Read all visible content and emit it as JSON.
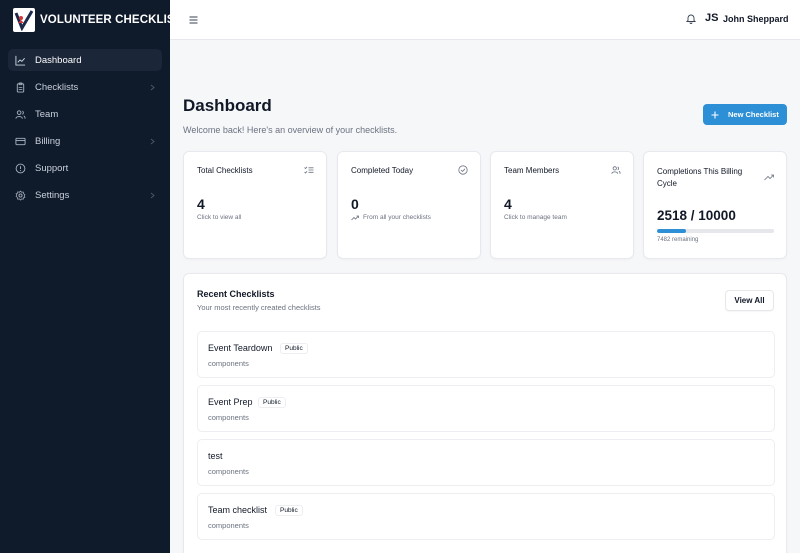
{
  "brand": {
    "name": "VOLUNTEER CHECKLIST"
  },
  "sidebar": {
    "items": [
      {
        "label": "Dashboard",
        "icon": "chart-line-icon"
      },
      {
        "label": "Checklists",
        "icon": "clipboard-icon"
      },
      {
        "label": "Team",
        "icon": "users-icon"
      },
      {
        "label": "Billing",
        "icon": "credit-card-icon"
      },
      {
        "label": "Support",
        "icon": "help-circle-icon"
      },
      {
        "label": "Settings",
        "icon": "gear-icon"
      }
    ]
  },
  "header": {
    "avatar_initials": "JS",
    "user_name": "John Sheppard"
  },
  "page": {
    "title": "Dashboard",
    "subtitle": "Welcome back! Here's an overview of your checklists.",
    "new_button": "New Checklist"
  },
  "stats": {
    "total": {
      "title": "Total Checklists",
      "value": "4",
      "note": "Click to view all"
    },
    "completed": {
      "title": "Completed Today",
      "value": "0",
      "note": "From all your checklists"
    },
    "team": {
      "title": "Team Members",
      "value": "4",
      "note": "Click to manage team"
    },
    "billing": {
      "title": "Completions This Billing Cycle",
      "value": "2518 / 10000",
      "note": "7482 remaining",
      "progress": 0.2518
    }
  },
  "recent": {
    "title": "Recent Checklists",
    "subtitle": "Your most recently created checklists",
    "view_all": "View All",
    "items": [
      {
        "name": "Event Teardown",
        "badge": "Public",
        "meta": "components"
      },
      {
        "name": "Event Prep",
        "badge": "Public",
        "meta": "components"
      },
      {
        "name": "test",
        "badge": "",
        "meta": "components"
      },
      {
        "name": "Team checklist",
        "badge": "Public",
        "meta": "components"
      }
    ]
  },
  "colors": {
    "sidebar": "#0f1a2b",
    "accent": "#2d8fd6",
    "background": "#f6f7f9"
  }
}
